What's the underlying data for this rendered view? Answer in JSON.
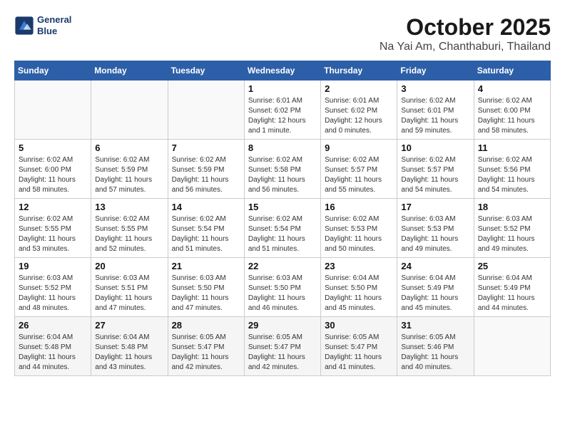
{
  "header": {
    "logo_line1": "General",
    "logo_line2": "Blue",
    "month": "October 2025",
    "location": "Na Yai Am, Chanthaburi, Thailand"
  },
  "days_of_week": [
    "Sunday",
    "Monday",
    "Tuesday",
    "Wednesday",
    "Thursday",
    "Friday",
    "Saturday"
  ],
  "weeks": [
    [
      {
        "day": "",
        "info": ""
      },
      {
        "day": "",
        "info": ""
      },
      {
        "day": "",
        "info": ""
      },
      {
        "day": "1",
        "info": "Sunrise: 6:01 AM\nSunset: 6:02 PM\nDaylight: 12 hours\nand 1 minute."
      },
      {
        "day": "2",
        "info": "Sunrise: 6:01 AM\nSunset: 6:02 PM\nDaylight: 12 hours\nand 0 minutes."
      },
      {
        "day": "3",
        "info": "Sunrise: 6:02 AM\nSunset: 6:01 PM\nDaylight: 11 hours\nand 59 minutes."
      },
      {
        "day": "4",
        "info": "Sunrise: 6:02 AM\nSunset: 6:00 PM\nDaylight: 11 hours\nand 58 minutes."
      }
    ],
    [
      {
        "day": "5",
        "info": "Sunrise: 6:02 AM\nSunset: 6:00 PM\nDaylight: 11 hours\nand 58 minutes."
      },
      {
        "day": "6",
        "info": "Sunrise: 6:02 AM\nSunset: 5:59 PM\nDaylight: 11 hours\nand 57 minutes."
      },
      {
        "day": "7",
        "info": "Sunrise: 6:02 AM\nSunset: 5:59 PM\nDaylight: 11 hours\nand 56 minutes."
      },
      {
        "day": "8",
        "info": "Sunrise: 6:02 AM\nSunset: 5:58 PM\nDaylight: 11 hours\nand 56 minutes."
      },
      {
        "day": "9",
        "info": "Sunrise: 6:02 AM\nSunset: 5:57 PM\nDaylight: 11 hours\nand 55 minutes."
      },
      {
        "day": "10",
        "info": "Sunrise: 6:02 AM\nSunset: 5:57 PM\nDaylight: 11 hours\nand 54 minutes."
      },
      {
        "day": "11",
        "info": "Sunrise: 6:02 AM\nSunset: 5:56 PM\nDaylight: 11 hours\nand 54 minutes."
      }
    ],
    [
      {
        "day": "12",
        "info": "Sunrise: 6:02 AM\nSunset: 5:55 PM\nDaylight: 11 hours\nand 53 minutes."
      },
      {
        "day": "13",
        "info": "Sunrise: 6:02 AM\nSunset: 5:55 PM\nDaylight: 11 hours\nand 52 minutes."
      },
      {
        "day": "14",
        "info": "Sunrise: 6:02 AM\nSunset: 5:54 PM\nDaylight: 11 hours\nand 51 minutes."
      },
      {
        "day": "15",
        "info": "Sunrise: 6:02 AM\nSunset: 5:54 PM\nDaylight: 11 hours\nand 51 minutes."
      },
      {
        "day": "16",
        "info": "Sunrise: 6:02 AM\nSunset: 5:53 PM\nDaylight: 11 hours\nand 50 minutes."
      },
      {
        "day": "17",
        "info": "Sunrise: 6:03 AM\nSunset: 5:53 PM\nDaylight: 11 hours\nand 49 minutes."
      },
      {
        "day": "18",
        "info": "Sunrise: 6:03 AM\nSunset: 5:52 PM\nDaylight: 11 hours\nand 49 minutes."
      }
    ],
    [
      {
        "day": "19",
        "info": "Sunrise: 6:03 AM\nSunset: 5:52 PM\nDaylight: 11 hours\nand 48 minutes."
      },
      {
        "day": "20",
        "info": "Sunrise: 6:03 AM\nSunset: 5:51 PM\nDaylight: 11 hours\nand 47 minutes."
      },
      {
        "day": "21",
        "info": "Sunrise: 6:03 AM\nSunset: 5:50 PM\nDaylight: 11 hours\nand 47 minutes."
      },
      {
        "day": "22",
        "info": "Sunrise: 6:03 AM\nSunset: 5:50 PM\nDaylight: 11 hours\nand 46 minutes."
      },
      {
        "day": "23",
        "info": "Sunrise: 6:04 AM\nSunset: 5:50 PM\nDaylight: 11 hours\nand 45 minutes."
      },
      {
        "day": "24",
        "info": "Sunrise: 6:04 AM\nSunset: 5:49 PM\nDaylight: 11 hours\nand 45 minutes."
      },
      {
        "day": "25",
        "info": "Sunrise: 6:04 AM\nSunset: 5:49 PM\nDaylight: 11 hours\nand 44 minutes."
      }
    ],
    [
      {
        "day": "26",
        "info": "Sunrise: 6:04 AM\nSunset: 5:48 PM\nDaylight: 11 hours\nand 44 minutes."
      },
      {
        "day": "27",
        "info": "Sunrise: 6:04 AM\nSunset: 5:48 PM\nDaylight: 11 hours\nand 43 minutes."
      },
      {
        "day": "28",
        "info": "Sunrise: 6:05 AM\nSunset: 5:47 PM\nDaylight: 11 hours\nand 42 minutes."
      },
      {
        "day": "29",
        "info": "Sunrise: 6:05 AM\nSunset: 5:47 PM\nDaylight: 11 hours\nand 42 minutes."
      },
      {
        "day": "30",
        "info": "Sunrise: 6:05 AM\nSunset: 5:47 PM\nDaylight: 11 hours\nand 41 minutes."
      },
      {
        "day": "31",
        "info": "Sunrise: 6:05 AM\nSunset: 5:46 PM\nDaylight: 11 hours\nand 40 minutes."
      },
      {
        "day": "",
        "info": ""
      }
    ]
  ]
}
